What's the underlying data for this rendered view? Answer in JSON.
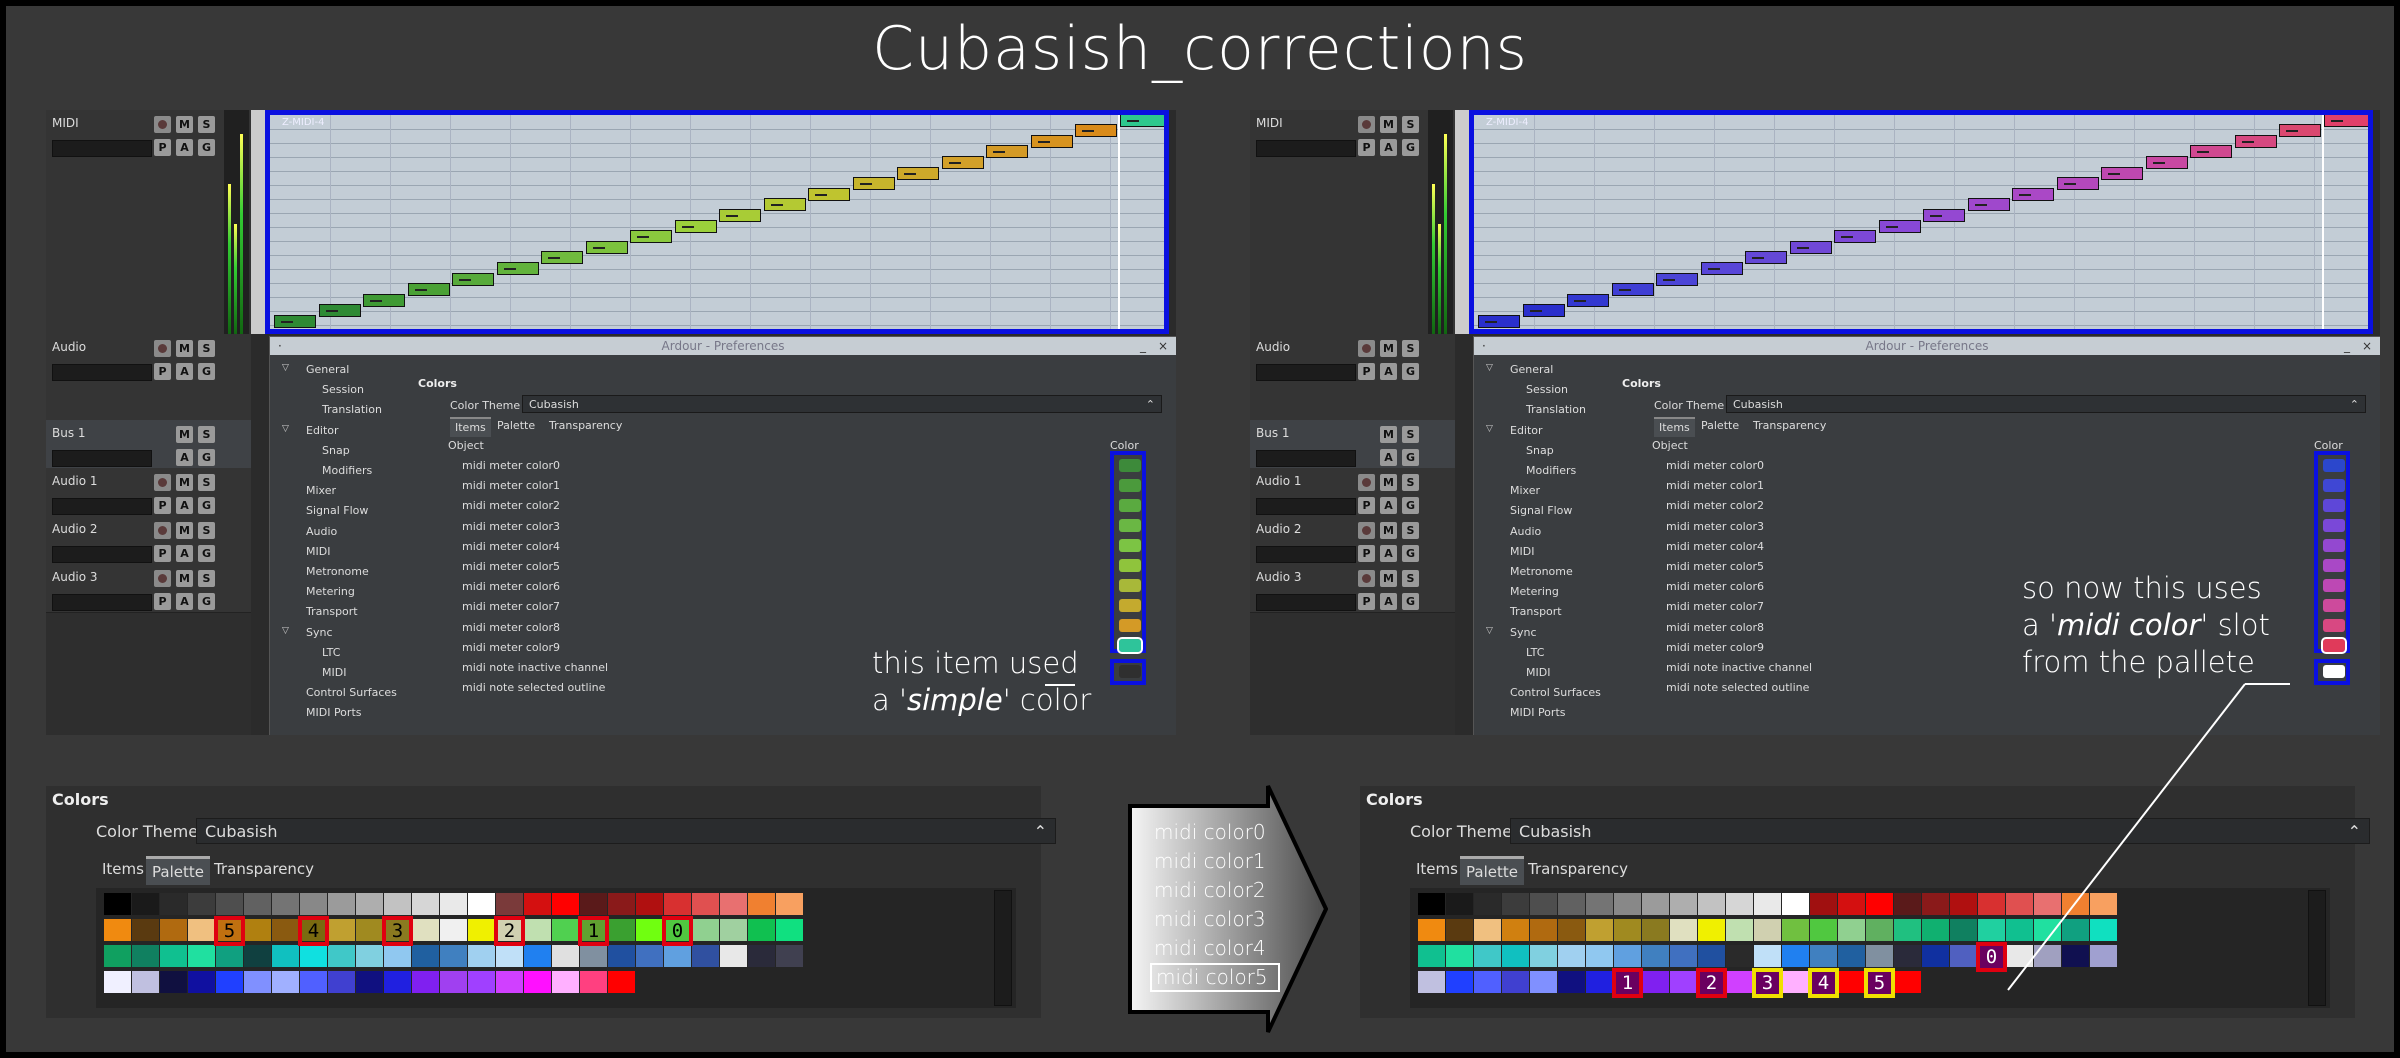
{
  "title": "Cubasish_corrections",
  "left_shot": {
    "region_label": "Z-MIDI-4",
    "note_colors": [
      "#2e8a34",
      "#2e8a34",
      "#3f9a34",
      "#4aa135",
      "#57aa3a",
      "#62b33c",
      "#70bb3e",
      "#7cc23d",
      "#8ac93e",
      "#9bd03b",
      "#a8cc36",
      "#b4c933",
      "#bfc42f",
      "#c7b52c",
      "#cda92a",
      "#d2a029",
      "#d49a26",
      "#d7931f",
      "#d98b1a",
      "#2ec88e"
    ],
    "swatch_colors": [
      "#3d8a3a",
      "#4b9a3c",
      "#5aaa40",
      "#6ab744",
      "#7cc444",
      "#8fc43c",
      "#a8b839",
      "#c4aa2e",
      "#d49a26",
      "#2ec49a",
      "#2f2f2f"
    ]
  },
  "right_shot": {
    "region_label": "Z-MIDI-4",
    "note_colors": [
      "#2a2fcc",
      "#2a2fcc",
      "#3338d0",
      "#3f3ed4",
      "#4b44d6",
      "#5846d8",
      "#6448d6",
      "#7048d6",
      "#7c48d6",
      "#8848d6",
      "#9448d2",
      "#9f48cc",
      "#aa48c6",
      "#b448bc",
      "#be48b0",
      "#c848a2",
      "#d04890",
      "#d64880",
      "#da4870",
      "#e0406a"
    ],
    "swatch_colors": [
      "#2b47cc",
      "#3f47d4",
      "#5e47d8",
      "#7a48d8",
      "#9348d0",
      "#a948c6",
      "#bd48b4",
      "#cd4a9c",
      "#d84882",
      "#e03a5a",
      "#ffffff"
    ]
  },
  "tracks": [
    {
      "name": "MIDI",
      "type": "midi"
    },
    {
      "name": "Audio",
      "type": "audio"
    },
    {
      "name": "Bus 1",
      "type": "bus"
    },
    {
      "name": "Audio 1",
      "type": "audio"
    },
    {
      "name": "Audio 2",
      "type": "audio"
    },
    {
      "name": "Audio 3",
      "type": "audio"
    }
  ],
  "buttons": {
    "m": "M",
    "s": "S",
    "p": "P",
    "a": "A",
    "g": "G"
  },
  "prefs": {
    "window_title": "Ardour - Preferences",
    "close": "×",
    "minimize": "_",
    "menu": "·",
    "nav": [
      {
        "label": "General",
        "expander": "▽",
        "level": 0
      },
      {
        "label": "Session",
        "level": 1
      },
      {
        "label": "Translation",
        "level": 1
      },
      {
        "label": "Editor",
        "expander": "▽",
        "level": 0
      },
      {
        "label": "Snap",
        "level": 1
      },
      {
        "label": "Modifiers",
        "level": 1
      },
      {
        "label": "Mixer",
        "level": 0
      },
      {
        "label": "Signal Flow",
        "level": 0
      },
      {
        "label": "Audio",
        "level": 0
      },
      {
        "label": "MIDI",
        "level": 0
      },
      {
        "label": "Metronome",
        "level": 0
      },
      {
        "label": "Metering",
        "level": 0
      },
      {
        "label": "Transport",
        "level": 0
      },
      {
        "label": "Sync",
        "expander": "▽",
        "level": 0
      },
      {
        "label": "LTC",
        "level": 1
      },
      {
        "label": "MIDI",
        "level": 1
      },
      {
        "label": "Control Surfaces",
        "level": 0
      },
      {
        "label": "MIDI Ports",
        "level": 0
      }
    ],
    "section": "Colors",
    "theme_label": "Color Theme",
    "theme_value": "Cubasish",
    "combo_arrow": "⌃",
    "tabs": [
      "Items",
      "Palette",
      "Transparency"
    ],
    "col_object": "Object",
    "col_color": "Color",
    "objects": [
      "midi meter color0",
      "midi meter color1",
      "midi meter color2",
      "midi meter color3",
      "midi meter color4",
      "midi meter color5",
      "midi meter color6",
      "midi meter color7",
      "midi meter color8",
      "midi meter color9",
      "midi note inactive channel",
      "midi note selected outline"
    ]
  },
  "annotations": {
    "left_line1": "this item used",
    "left_line2_pre": "a '",
    "left_line2_em": "simple",
    "left_line2_post": "' color",
    "right_line1": "so now this uses",
    "right_line2_pre": "a '",
    "right_line2_em": "midi color",
    "right_line2_post": "' slot",
    "right_line3": "from the pallete"
  },
  "palette": {
    "heading": "Colors",
    "theme_label": "Color Theme",
    "theme_value": "Cubasish",
    "combo_arrow": "⌃",
    "tabs": [
      "Items",
      "Palette",
      "Transparency"
    ],
    "left_rows": [
      [
        "#000000",
        "#1a1a1a",
        "#2a2a2a",
        "#3c3c3c",
        "#4e4e4e",
        "#616161",
        "#747474",
        "#888888",
        "#9b9b9b",
        "#aeaeae",
        "#c2c2c2",
        "#d6d6d6",
        "#e9e9e9",
        "#ffffff",
        "#7a3a3a",
        "#d41010",
        "#ff0000",
        "#5a1a1a",
        "#8a1a1a",
        "#b01010",
        "#d83030",
        "#e05050",
        "#e87070",
        "#f08030",
        "#f8a060"
      ],
      [
        "#f08a10",
        "#5a3a10",
        "#b06a10",
        "#f0c080",
        "#c07010",
        "#b08010",
        "#8a5a10",
        "#7a6a10",
        "#c0a030",
        "#a08a20",
        "#8a7a20",
        "#e0e0c0",
        "#f0f0f0",
        "#f0f000",
        "#d0d0b0",
        "#c0e0b0",
        "#50d050",
        "#60a030",
        "#3aa030",
        "#70ff10",
        "#50c840",
        "#90d090",
        "#a0d0a0",
        "#10c050",
        "#10e080"
      ],
      [
        "#10a060",
        "#108060",
        "#10c090",
        "#20e0a0",
        "#10a080",
        "#104040",
        "#10c0c0",
        "#10e0e0",
        "#40c8c8",
        "#80d0e0",
        "#90c8f0",
        "#2060a0",
        "#4080c0",
        "#a0d0f0",
        "#c0e0f8",
        "#2080f0",
        "#e0e0e0",
        "#8090a0",
        "#2050a0",
        "#4070c0",
        "#60a0e0",
        "#3050a0",
        "#e8e8e8",
        "#2a2a3a",
        "#404050"
      ],
      [
        "#f0f0ff",
        "#c0c0e0",
        "#101040",
        "#1010a0",
        "#2040ff",
        "#8090ff",
        "#a0b0ff",
        "#5060ff",
        "#4040d0",
        "#101080",
        "#2020e0",
        "#8020f0",
        "#a040f0",
        "#a040ff",
        "#d040ff",
        "#ff10ff",
        "#ffb0ff",
        "#ff4080",
        "#ff0000"
      ]
    ],
    "right_rows": [
      [
        "#000000",
        "#1a1a1a",
        "#2a2a2a",
        "#3c3c3c",
        "#4e4e4e",
        "#616161",
        "#747474",
        "#888888",
        "#9b9b9b",
        "#aeaeae",
        "#c2c2c2",
        "#d6d6d6",
        "#e9e9e9",
        "#ffffff",
        "#a01010",
        "#d41010",
        "#ff0000",
        "#5a1a1a",
        "#8a1a1a",
        "#b01010",
        "#d83030",
        "#e05050",
        "#e87070",
        "#f08030",
        "#f8a060"
      ],
      [
        "#f08a10",
        "#5a3a10",
        "#f0c080",
        "#d08010",
        "#b06a10",
        "#8a5a10",
        "#c0a030",
        "#a08a20",
        "#8a7a20",
        "#e0e0c0",
        "#f0f000",
        "#c0e0b0",
        "#d0d0b0",
        "#70c040",
        "#50c840",
        "#90d090",
        "#60b060",
        "#20c080",
        "#10b070",
        "#108060",
        "#20d0a0",
        "#10c090",
        "#20e0a0",
        "#10a080",
        "#10e0c0"
      ],
      [
        "#10c090",
        "#20e0a0",
        "#40c8c8",
        "#10c0c0",
        "#80d0e0",
        "#a0d0f0",
        "#90c8f0",
        "#60a0e0",
        "#4080c0",
        "#4070c0",
        "#2050a0",
        "#2a2a2a",
        "#c0e0f8",
        "#2080f0",
        "#4080c0",
        "#2060a0",
        "#8090a0",
        "#2a2a3a",
        "#1030a0",
        "#5060c0",
        "#8090c0",
        "#e8e8e8",
        "#a0a0c0",
        "#101050",
        "#a0a0d0"
      ],
      [
        "#c0c0e0",
        "#2040ff",
        "#5060ff",
        "#4040d0",
        "#8090ff",
        "#101080",
        "#2020e0",
        "#6040e0",
        "#8020f0",
        "#a040ff",
        "#c040ff",
        "#d040ff",
        "#ff10ff",
        "#ffb0ff",
        "#ff4080",
        "#ff0000",
        "#e02060",
        "#ff0000"
      ]
    ],
    "left_badges": [
      {
        "label": "5",
        "row": 1,
        "col": 4
      },
      {
        "label": "4",
        "row": 1,
        "col": 7
      },
      {
        "label": "3",
        "row": 1,
        "col": 10
      },
      {
        "label": "2",
        "row": 1,
        "col": 14
      },
      {
        "label": "1",
        "row": 1,
        "col": 17
      },
      {
        "label": "0",
        "row": 1,
        "col": 20
      }
    ],
    "right_badges": [
      {
        "label": "1",
        "row": 3,
        "col": 7,
        "style": "red"
      },
      {
        "label": "2",
        "row": 3,
        "col": 10,
        "style": "red"
      },
      {
        "label": "3",
        "row": 3,
        "col": 12,
        "style": "yellow"
      },
      {
        "label": "4",
        "row": 3,
        "col": 14,
        "style": "yellow"
      },
      {
        "label": "5",
        "row": 3,
        "col": 16,
        "style": "yellow"
      },
      {
        "label": "0",
        "row": 2,
        "col": 20,
        "style": "red"
      }
    ]
  },
  "mapping_list": {
    "items": [
      "midi color0",
      "midi color1",
      "midi color2",
      "midi color3",
      "midi color4",
      "midi color5"
    ],
    "selected": 5
  }
}
